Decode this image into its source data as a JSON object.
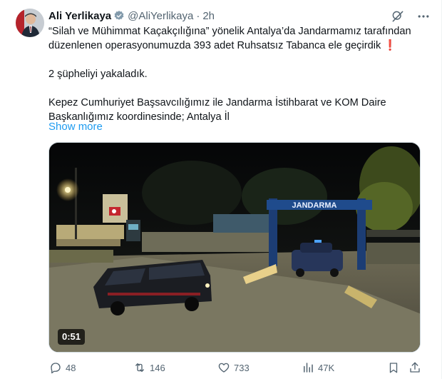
{
  "tweet": {
    "author_name": "Ali Yerlikaya",
    "handle": "@AliYerlikaya",
    "separator": "·",
    "time": "2h",
    "paragraphs": [
      "“Silah ve Mühimmat Kaçakçılığına” yönelik Antalya’da Jandarmamız tarafından düzenlenen operasyonumuzda 393 adet Ruhsatsız Tabanca ele geçirdik ❗",
      "2 şüpheliyi yakaladık.",
      "Kepez Cumhuriyet Başsavcılığımız ile Jandarma İstihbarat ve KOM Daire Başkanlığımız koordinesinde; Antalya İl"
    ],
    "show_more": "Show more"
  },
  "media": {
    "duration": "0:51",
    "gate_sign": "JANDARMA"
  },
  "actions": {
    "replies": "48",
    "reposts": "146",
    "likes": "733",
    "views": "47K"
  },
  "colors": {
    "accent": "#1d9bf0",
    "muted": "#536471",
    "text": "#0f1419"
  }
}
